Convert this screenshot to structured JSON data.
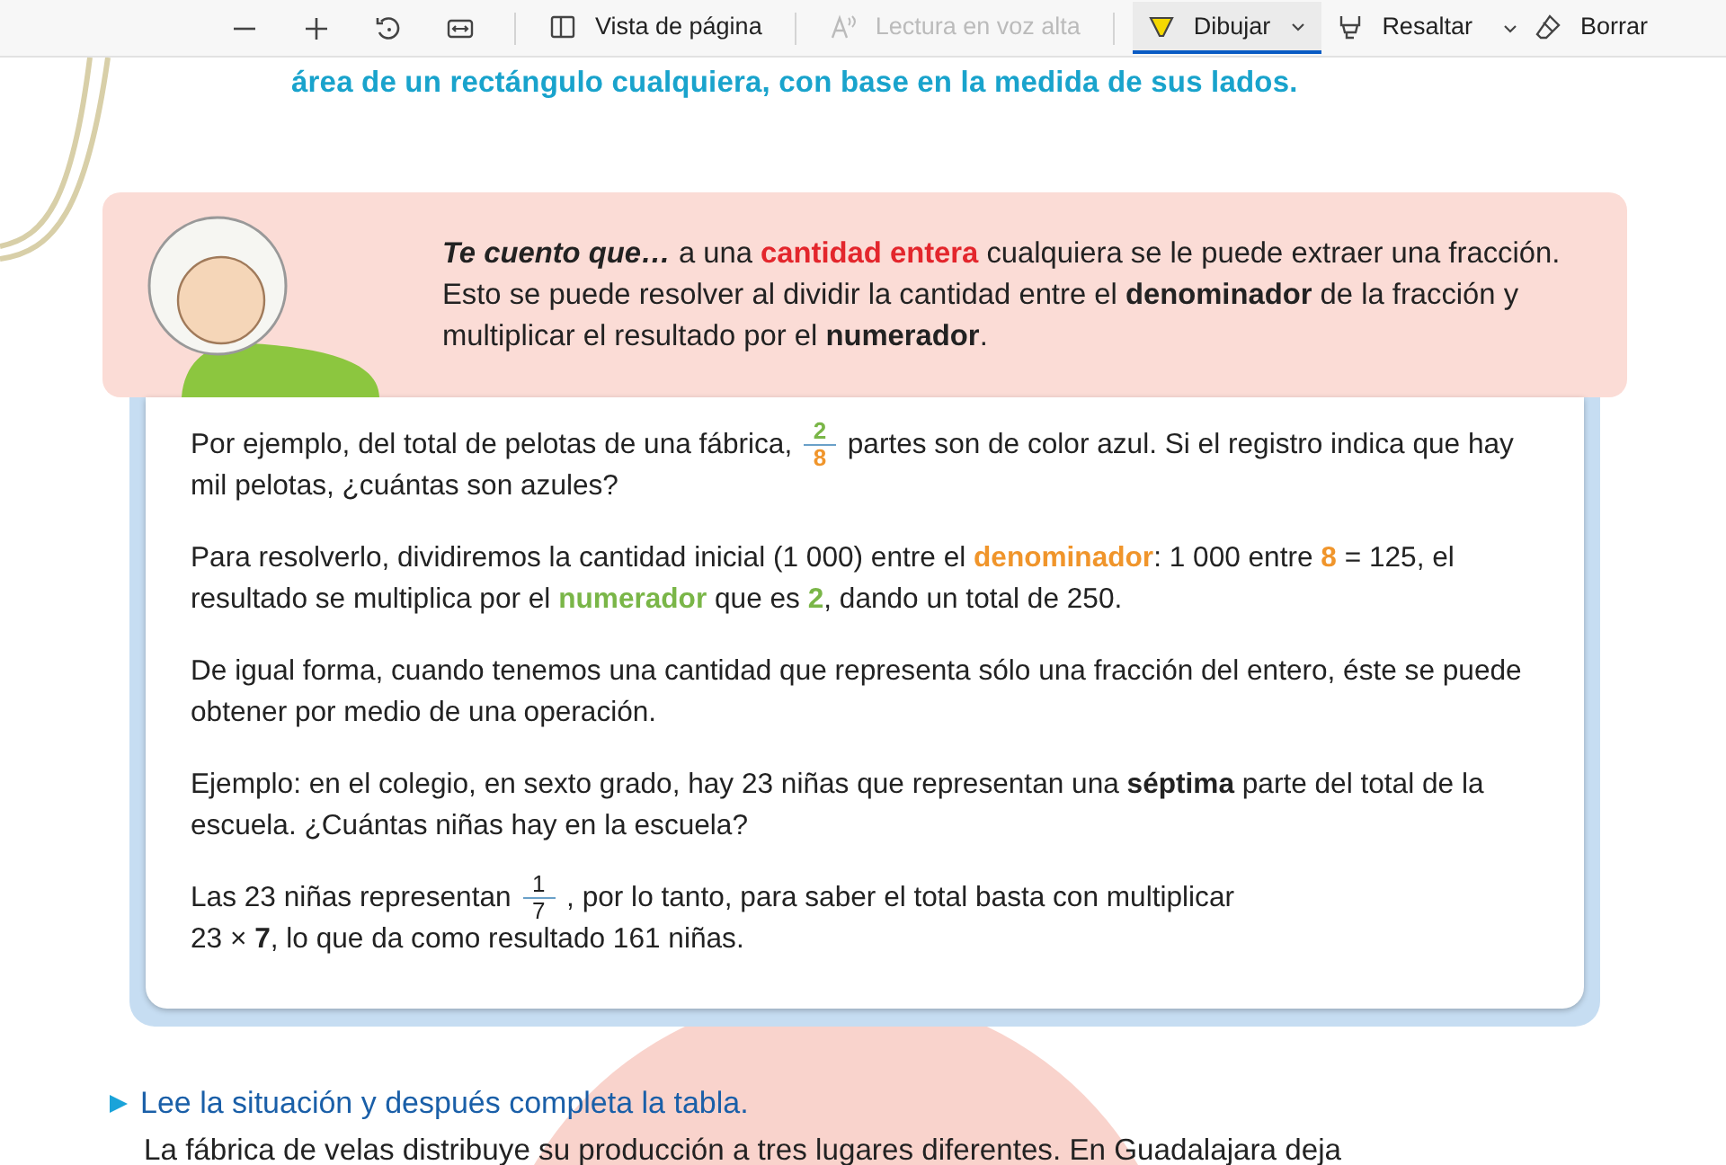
{
  "toolbar": {
    "buttons": [
      {
        "label": "Vista de página",
        "disabled": false,
        "selected": false,
        "menu": false
      },
      {
        "label": "Lectura en voz alta",
        "disabled": true,
        "selected": false,
        "menu": false
      },
      {
        "label": "Dibujar",
        "disabled": false,
        "selected": true,
        "menu": true
      },
      {
        "label": "Resaltar",
        "disabled": false,
        "selected": false,
        "menu": true
      },
      {
        "label": "Borrar",
        "disabled": false,
        "selected": false,
        "menu": false
      }
    ]
  },
  "page": {
    "heading": "área de un rectángulo cualquiera, con base en la medida de sus lados.",
    "callout": [
      {
        "kind": "title",
        "text": "Te cuento que…"
      },
      {
        "kind": "plain",
        "text": " a una "
      },
      {
        "kind": "strong",
        "text": "cantidad entera",
        "color": "#e3262c"
      },
      {
        "kind": "plain",
        "text": " cualquiera se le puede extraer una fracción. Esto se puede resolver al dividir la cantidad entre el "
      },
      {
        "kind": "strong",
        "text": "denominador"
      },
      {
        "kind": "plain",
        "text": " de la fracción y multiplicar el resultado por el "
      },
      {
        "kind": "strong",
        "text": "numerador"
      },
      {
        "kind": "plain",
        "text": "."
      }
    ],
    "example": [
      [
        {
          "kind": "plain",
          "text": "Por ejemplo, del total de pelotas de una fábrica, "
        },
        {
          "kind": "fraction",
          "numerator": {
            "text": "2",
            "color": "#7ab648"
          },
          "denominator": {
            "text": "8",
            "color": "#f0952b"
          }
        },
        {
          "kind": "plain",
          "text": " partes son de color azul. Si el registro indica que hay mil pelotas, ¿cuántas son azules?"
        }
      ],
      [
        {
          "kind": "plain",
          "text": "Para resolverlo, dividiremos la cantidad inicial (1 000) entre el "
        },
        {
          "kind": "strong",
          "text": "denominador",
          "color": "#f0952b"
        },
        {
          "kind": "plain",
          "text": ": 1 000 entre "
        },
        {
          "kind": "strong",
          "text": "8",
          "color": "#f0952b"
        },
        {
          "kind": "plain",
          "text": " = 125, el resultado se multiplica por el "
        },
        {
          "kind": "strong",
          "text": "numerador",
          "color": "#7ab648"
        },
        {
          "kind": "plain",
          "text": " que es "
        },
        {
          "kind": "strong",
          "text": "2",
          "color": "#7ab648"
        },
        {
          "kind": "plain",
          "text": ", dando un total de 250."
        }
      ],
      [
        {
          "kind": "plain",
          "text": "De igual forma, cuando tenemos una cantidad que representa sólo una fracción del entero, éste se puede obtener por medio de una operación."
        }
      ],
      [
        {
          "kind": "plain",
          "text": "Ejemplo: en el colegio, en sexto grado, hay 23 niñas que representan una "
        },
        {
          "kind": "strong",
          "text": "séptima"
        },
        {
          "kind": "plain",
          "text": " parte del total de la escuela. ¿Cuántas niñas hay en la escuela?"
        }
      ],
      [
        {
          "kind": "plain",
          "text": "Las 23 niñas representan "
        },
        {
          "kind": "fraction",
          "numerator": {
            "text": "1"
          },
          "denominator": {
            "text": "7"
          }
        },
        {
          "kind": "plain",
          "text": " , por lo tanto, para saber el total basta con multiplicar"
        },
        {
          "kind": "break"
        },
        {
          "kind": "plain",
          "text": "23 × "
        },
        {
          "kind": "strong",
          "text": "7"
        },
        {
          "kind": "plain",
          "text": ", lo que da como resultado 161 niñas."
        }
      ]
    ],
    "instruction": "Lee la situación y después completa la tabla.",
    "body": "La fábrica de velas distribuye su producción a tres lugares diferentes. En Guadalajara deja"
  }
}
